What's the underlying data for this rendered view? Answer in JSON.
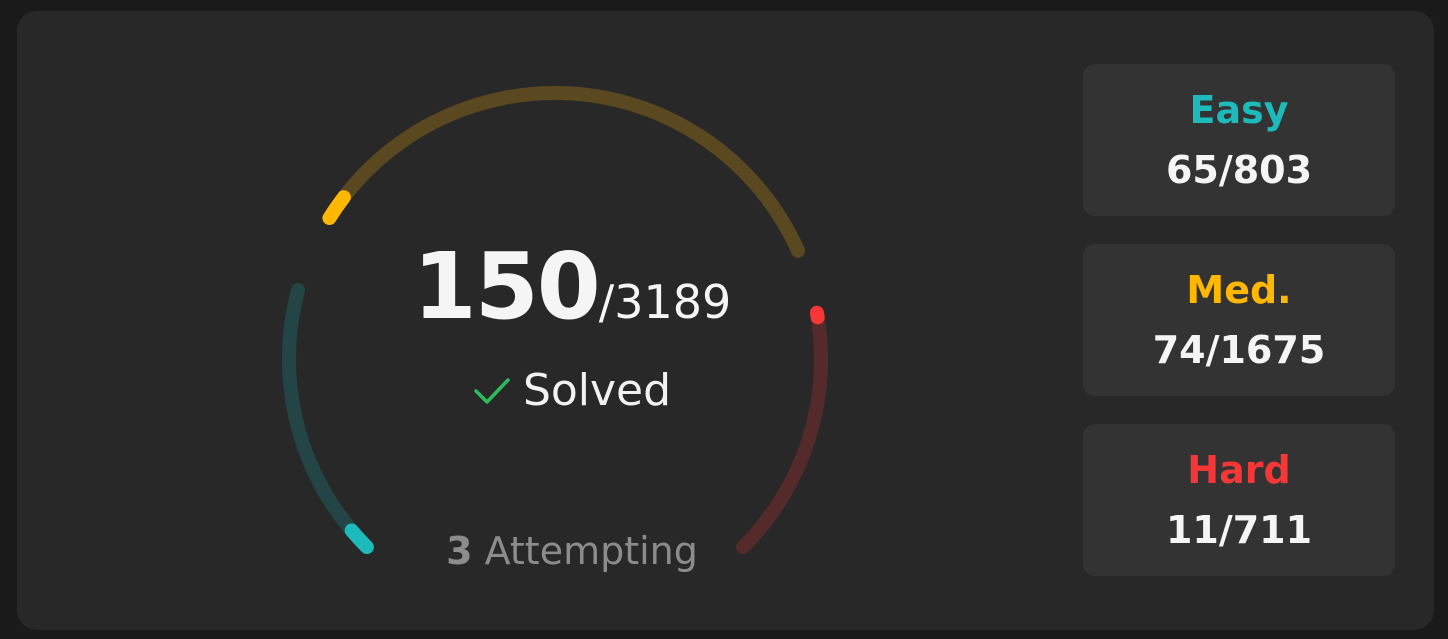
{
  "summary": {
    "solved": "150",
    "total": "/3189",
    "solved_label": "Solved",
    "attempting_count": "3",
    "attempting_label": "Attempting"
  },
  "difficulties": [
    {
      "label": "Easy",
      "value": "65/803",
      "color": "#1cbaba"
    },
    {
      "label": "Med.",
      "value": "74/1675",
      "color": "#ffb700"
    },
    {
      "label": "Hard",
      "value": "11/711",
      "color": "#f63737"
    }
  ],
  "colors": {
    "background": "#1a1a1a",
    "card": "#282828",
    "stat_box": "#333333",
    "check": "#2cbb5d",
    "easy_track": "#234545",
    "medium_track": "#5a4820",
    "hard_track": "#552a2a"
  },
  "progress": {
    "easy_fraction": 0.081,
    "medium_fraction": 0.044,
    "hard_fraction": 0.015
  }
}
